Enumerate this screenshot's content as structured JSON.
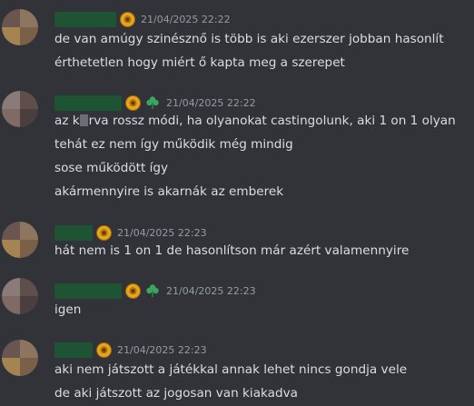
{
  "messages": [
    {
      "timestamp": "21/04/2025 22:22",
      "badges": [
        "coin-badge-icon"
      ],
      "lines": [
        "de van amúgy szinésznő is több is aki ezerszer jobban hasonlít",
        "érthetetlen hogy miért ő kapta meg a szerepet"
      ]
    },
    {
      "timestamp": "21/04/2025 22:22",
      "badges": [
        "coin-badge-icon",
        "clover-badge-icon"
      ],
      "lines": [
        "az k",
        "rva rossz módi, ha olyanokat castingolunk, aki 1 on 1 olyan",
        "tehát ez nem így működik még mindig",
        "sose működött így",
        "akármennyire is akarnák az emberek"
      ]
    },
    {
      "timestamp": "21/04/2025 22:23",
      "badges": [
        "coin-badge-icon"
      ],
      "lines": [
        "hát nem is 1 on 1 de hasonlítson már azért valamennyire"
      ]
    },
    {
      "timestamp": "21/04/2025 22:23",
      "badges": [
        "coin-badge-icon",
        "clover-badge-icon"
      ],
      "lines": [
        "igen"
      ]
    },
    {
      "timestamp": "21/04/2025 22:23",
      "badges": [
        "coin-badge-icon"
      ],
      "lines": [
        "aki nem játszott a játékkal annak lehet nincs gondja vele",
        "de aki játszott az jogosan van kiakadva"
      ]
    }
  ],
  "colors": {
    "background": "#313338",
    "text": "#dbdee1",
    "timestamp": "#949ba4",
    "username_redacted": "#1e5433",
    "coin_badge": "#e8a41c",
    "clover_badge": "#3ba55d"
  }
}
